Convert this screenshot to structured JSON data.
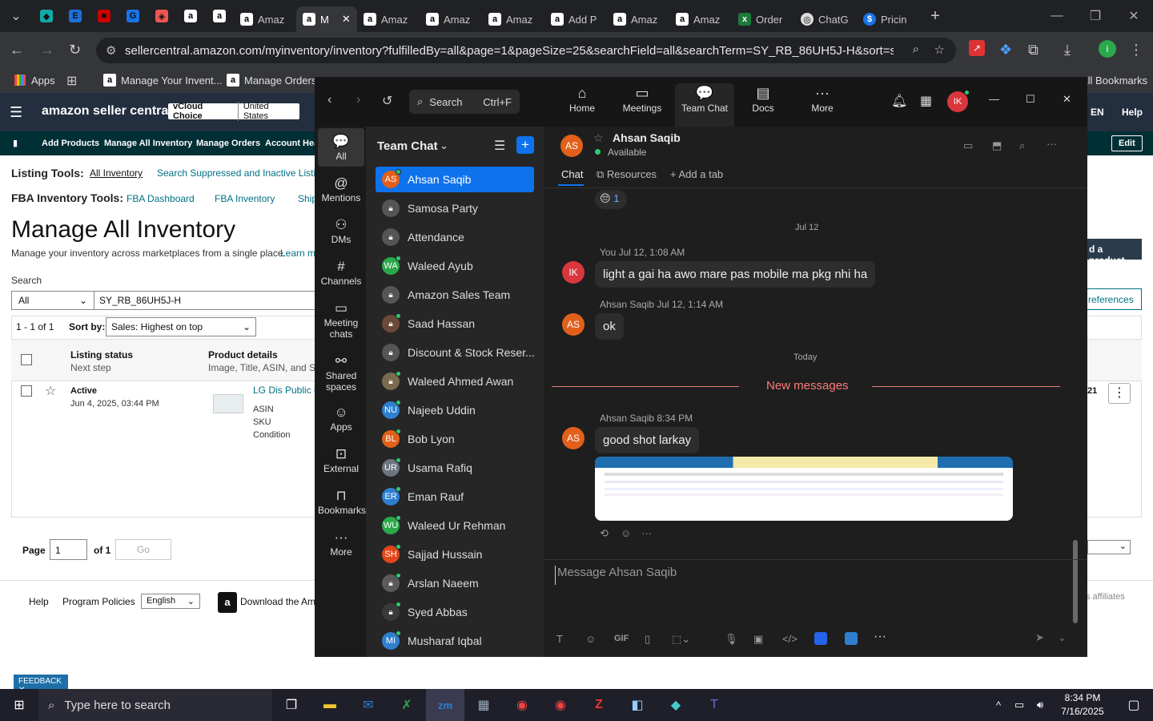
{
  "browser": {
    "tabs": [
      "Amaz",
      "M",
      "Amaz",
      "Amaz",
      "Amaz",
      "Add P",
      "Amaz",
      "Amaz",
      "Order",
      "ChatG",
      "Pricin"
    ],
    "url": "sellercentral.amazon.com/myinventory/inventory?fulfilledBy=all&page=1&pageSize=25&searchField=all&searchTerm=SY_RB_86UH5J-H&sort=sales_des...",
    "bookmarks": [
      "Apps",
      "Manage Your Invent...",
      "Manage Orders",
      "All Bookmarks"
    ],
    "profile_initial": "i"
  },
  "amazon": {
    "logo": "amazon seller central",
    "account": "vCloud Choice",
    "marketplace": "United States",
    "lang": "EN",
    "help": "Help",
    "nav": [
      "Add Products",
      "Manage All Inventory",
      "Manage Orders",
      "Account Heal"
    ],
    "edit": "Edit",
    "listing_tools_label": "Listing Tools:",
    "listing_tools": [
      "All Inventory",
      "Search Suppressed and Inactive Listing"
    ],
    "fba_tools_label": "FBA Inventory Tools:",
    "fba_tools": [
      "FBA Dashboard",
      "FBA Inventory",
      "Ship"
    ],
    "title": "Manage All Inventory",
    "subtitle": "Manage your inventory across marketplaces from a single place.",
    "learn_more": "Learn m",
    "search_label": "Search",
    "search_scope": "All",
    "search_value": "SY_RB_86UH5J-H",
    "add_product": "d a product",
    "preferences": "references",
    "count": "1 - 1 of 1",
    "sort_label": "Sort by:",
    "sort_value": "Sales: Highest on top",
    "col1_h": "Listing status",
    "col1_s": "Next step",
    "col2_h": "Product details",
    "col2_s": "Image, Title, ASIN, and SK",
    "row_status": "Active",
    "row_date": "Jun 4, 2025, 03:44 PM",
    "row_title": "LG Dis Public 8",
    "row_asin": "ASIN",
    "row_sku": "SKU",
    "row_condition": "Condition",
    "row_num": "21",
    "page_label": "Page",
    "page_value": "1",
    "page_of": "of 1",
    "go": "Go",
    "footer": [
      "Help",
      "Program Policies"
    ],
    "footer_lang": "English",
    "download": "Download the Ama",
    "affiliates": "s affiliates",
    "feedback": "FEEDBACK"
  },
  "zoom": {
    "search": "Search",
    "search_shortcut": "Ctrl+F",
    "topnav": [
      "Home",
      "Meetings",
      "Team Chat",
      "Docs",
      "More"
    ],
    "user_initials": "IK",
    "rail": [
      "All",
      "Mentions",
      "DMs",
      "Channels",
      "Meeting chats",
      "Shared spaces",
      "Apps",
      "External",
      "Bookmarks",
      "More"
    ],
    "list_title": "Team Chat",
    "contacts": [
      {
        "initials": "AS",
        "name": "Ahsan Saqib",
        "color": "#e2601a"
      },
      {
        "initials": "",
        "name": "Samosa Party",
        "color": "#555"
      },
      {
        "initials": "",
        "name": "Attendance",
        "color": "#555"
      },
      {
        "initials": "WA",
        "name": "Waleed Ayub",
        "color": "#2aa84a"
      },
      {
        "initials": "",
        "name": "Amazon Sales Team",
        "color": "#555"
      },
      {
        "initials": "",
        "name": "Saad Hassan",
        "color": "#6b4a3a"
      },
      {
        "initials": "",
        "name": "Discount & Stock Reser...",
        "color": "#555"
      },
      {
        "initials": "",
        "name": "Waleed Ahmed Awan",
        "color": "#7a6a50"
      },
      {
        "initials": "NU",
        "name": "Najeeb Uddin",
        "color": "#2f7fd0"
      },
      {
        "initials": "BL",
        "name": "Bob Lyon",
        "color": "#e2601a"
      },
      {
        "initials": "UR",
        "name": "Usama Rafiq",
        "color": "#6d7480"
      },
      {
        "initials": "ER",
        "name": "Eman Rauf",
        "color": "#2f7fd0"
      },
      {
        "initials": "WU",
        "name": "Waleed Ur Rehman",
        "color": "#2aa84a"
      },
      {
        "initials": "SH",
        "name": "Sajjad Hussain",
        "color": "#e2451a"
      },
      {
        "initials": "",
        "name": "Arslan Naeem",
        "color": "#5a5a5a"
      },
      {
        "initials": "",
        "name": "Syed Abbas",
        "color": "#3a3a3a"
      },
      {
        "initials": "MI",
        "name": "Musharaf Iqbal",
        "color": "#2f7fd0"
      }
    ],
    "chat_name": "Ahsan Saqib",
    "chat_initials": "AS",
    "chat_status": "Available",
    "tabs": [
      "Chat",
      "Resources",
      "Add a tab"
    ],
    "reaction_count": "1",
    "date1": "Jul 12",
    "m1_meta": "You Jul 12, 1:08 AM",
    "m1_text": "light a gai ha awo mare pas mobile ma pkg nhi ha",
    "m2_meta": "Ahsan Saqib Jul 12, 1:14 AM",
    "m2_text": "ok",
    "date2": "Today",
    "new_messages": "New messages",
    "m3_meta": "Ahsan Saqib 8:34 PM",
    "m3_text": "good shot larkay",
    "placeholder": "Message Ahsan Saqib"
  },
  "taskbar": {
    "search": "Type here to search",
    "time": "8:34 PM",
    "date": "7/16/2025"
  }
}
